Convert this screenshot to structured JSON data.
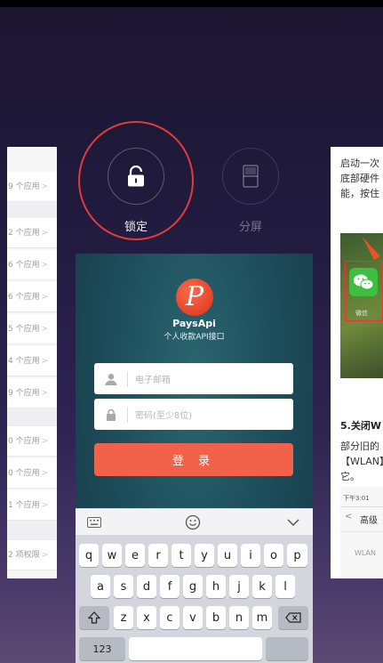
{
  "actions": {
    "lock_label": "锁定",
    "split_label": "分屏"
  },
  "left_card": {
    "rows": [
      "9 个应用",
      "2 个应用",
      "6 个应用",
      "6 个应用",
      "5 个应用",
      "4 个应用",
      "9 个应用",
      "0 个应用",
      "0 个应用",
      "1 个应用",
      "2 项权限"
    ],
    "chevron": ">"
  },
  "app": {
    "logo_letter": "P",
    "name": "PaysApi",
    "subtitle": "个人收款API接口",
    "email_placeholder": "电子邮箱",
    "password_placeholder": "密码(至少8位)",
    "login_label": "登 录"
  },
  "keyboard": {
    "row1": [
      "q",
      "w",
      "e",
      "r",
      "t",
      "y",
      "u",
      "i",
      "o",
      "p"
    ],
    "row2": [
      "a",
      "s",
      "d",
      "f",
      "g",
      "h",
      "j",
      "k",
      "l"
    ],
    "row3": [
      "z",
      "x",
      "c",
      "v",
      "b",
      "n",
      "m"
    ],
    "bottom": [
      "123"
    ]
  },
  "right_card": {
    "lines": [
      "启动一次",
      "底部硬件",
      "能，按住"
    ],
    "weixin_label": "微信",
    "heading": "5.关闭W",
    "para": [
      "部分旧的",
      "【WLAN】",
      "它。"
    ],
    "status_time": "下午3:01",
    "sub_title": "高级",
    "sub_row": "WLAN"
  }
}
